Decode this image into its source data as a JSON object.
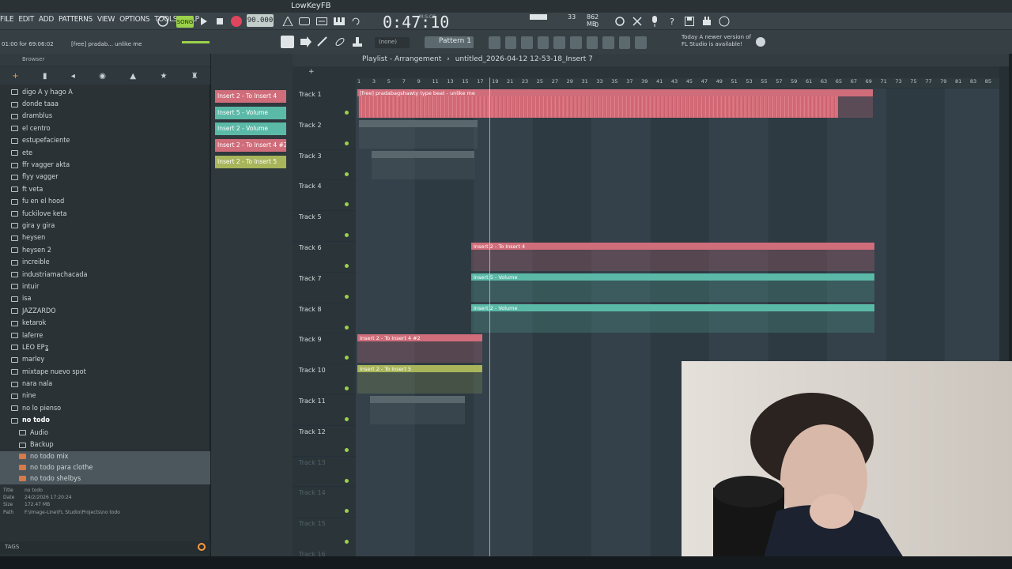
{
  "window": {
    "title": "LowKeyFB"
  },
  "menu": [
    "FILE",
    "EDIT",
    "ADD",
    "PATTERNS",
    "VIEW",
    "OPTIONS",
    "TOOLS",
    "HELP"
  ],
  "transport": {
    "mode_label": "SONG",
    "tempo": "90.000",
    "time": "0:47:10",
    "time_unit": "M:S:CS",
    "cpu_value": "33",
    "memory": "862 MB",
    "poly": "0"
  },
  "hint": {
    "position": "01:00 for 69:06:02",
    "hint_text": "[free] pradab... unlike me"
  },
  "snap": "(none)",
  "pattern": "Pattern 1",
  "news": {
    "line1": "Today  A newer version of",
    "line2": "FL Studio is available!"
  },
  "browser": {
    "header": "Browser",
    "items": [
      {
        "label": "digo A y hago A",
        "type": "folder"
      },
      {
        "label": "donde taaa",
        "type": "folder"
      },
      {
        "label": "dramblus",
        "type": "folder"
      },
      {
        "label": "el centro",
        "type": "folder"
      },
      {
        "label": "estupefaciente",
        "type": "folder"
      },
      {
        "label": "ete",
        "type": "folder"
      },
      {
        "label": "ffr vagger akta",
        "type": "folder"
      },
      {
        "label": "flyy vagger",
        "type": "folder"
      },
      {
        "label": "ft veta",
        "type": "folder"
      },
      {
        "label": "fu en el hood",
        "type": "folder"
      },
      {
        "label": "fuckilove keta",
        "type": "folder"
      },
      {
        "label": "gira y gira",
        "type": "folder"
      },
      {
        "label": "heysen",
        "type": "folder"
      },
      {
        "label": "heysen 2",
        "type": "folder"
      },
      {
        "label": "increible",
        "type": "folder"
      },
      {
        "label": "industriamachacada",
        "type": "folder"
      },
      {
        "label": "intuir",
        "type": "folder"
      },
      {
        "label": "isa",
        "type": "folder"
      },
      {
        "label": "JAZZARDO",
        "type": "folder"
      },
      {
        "label": "ketarok",
        "type": "folder"
      },
      {
        "label": "laferre",
        "type": "folder"
      },
      {
        "label": "LEO EPʓ",
        "type": "folder"
      },
      {
        "label": "marley",
        "type": "folder"
      },
      {
        "label": "mixtape nuevo spot",
        "type": "folder"
      },
      {
        "label": "nara nala",
        "type": "folder"
      },
      {
        "label": "nine",
        "type": "folder"
      },
      {
        "label": "no lo pienso",
        "type": "folder"
      },
      {
        "label": "no todo",
        "type": "folder-open"
      },
      {
        "label": "Audio",
        "type": "subfolder"
      },
      {
        "label": "Backup",
        "type": "subfolder"
      },
      {
        "label": "no todo mix",
        "type": "file"
      },
      {
        "label": "no todo para clothe",
        "type": "file"
      },
      {
        "label": "no todo shelbys",
        "type": "file"
      }
    ],
    "info": {
      "title_key": "Title",
      "title_val": "no todo",
      "date_key": "Date",
      "date_val": "24/2/2026 17:20:24",
      "size_key": "Size",
      "size_val": "172.47 MB",
      "path_key": "Path",
      "path_val": "F:\\Image-Line\\FL Studio\\Projects\\no todo"
    },
    "tags_label": "TAGS"
  },
  "clip_list": [
    {
      "label": "Insert 2 - To Insert 4",
      "color": "#d06d7a"
    },
    {
      "label": "Insert 5 - Volume",
      "color": "#5bb9a8"
    },
    {
      "label": "Insert 2 - Volume",
      "color": "#5bb9a8"
    },
    {
      "label": "Insert 2 - To Insert 4 #2",
      "color": "#d06d7a"
    },
    {
      "label": "Insert 2 - To Insert 5",
      "color": "#a8b55a"
    }
  ],
  "playlist": {
    "title": "Playlist - Arrangement",
    "project": "untitled_2026-04-12 12-53-18_Insert 7",
    "ruler": [
      "1",
      "3",
      "5",
      "7",
      "9",
      "11",
      "13",
      "15",
      "17",
      "19",
      "21",
      "23",
      "25",
      "27",
      "29",
      "31",
      "33",
      "35",
      "37",
      "39",
      "41",
      "43",
      "45",
      "47",
      "49",
      "51",
      "53",
      "55",
      "57",
      "59",
      "61",
      "63",
      "65",
      "67",
      "69",
      "71",
      "73",
      "75",
      "77",
      "79",
      "81",
      "83",
      "85"
    ],
    "tracks": [
      "Track 1",
      "Track 2",
      "Track 3",
      "Track 4",
      "Track 5",
      "Track 6",
      "Track 7",
      "Track 8",
      "Track 9",
      "Track 10",
      "Track 11",
      "Track 12",
      "Track 13",
      "Track 14",
      "Track 15",
      "Track 16"
    ],
    "clips": {
      "audio": "[free] pradabagshawty type beat - unlike me",
      "t6": "Insert 2 - To Insert 4",
      "t7": "Insert 5 - Volume",
      "t8": "Insert 2 - Volume",
      "t9": "Insert 2 - To Insert 4 #2",
      "t10": "Insert 2 - To Insert 5"
    }
  }
}
